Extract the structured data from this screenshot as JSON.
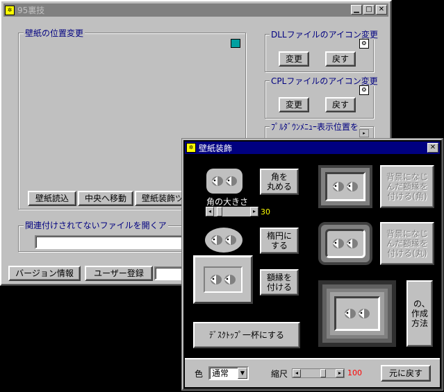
{
  "main_window": {
    "title": "95裏技",
    "wallpaper_group": "壁紙の位置変更",
    "dll_group": "DLLファイルのアイコン変更",
    "dll_change": "変更",
    "dll_back": "戻す",
    "cpl_group": "CPLファイルのアイコン変更",
    "cpl_change": "変更",
    "cpl_back": "戻す",
    "pulldown_group": "ﾌﾟﾙﾀﾞｳﾝﾒﾆｭｰ表示位置を",
    "load_button": "壁紙読込",
    "center_button": "中央へ移動",
    "decor_button": "壁紙装飾ツ",
    "open_group": "関連付けされてないファイルを開くア",
    "open_input": "",
    "version_button": "バージョン情報",
    "register_button": "ユーザー登録",
    "register_input": ""
  },
  "decor_window": {
    "title": "壁紙装飾",
    "round_button": "角を\n丸める",
    "corner_size_label": "角の大きさ",
    "corner_size_value": "30",
    "oval_button": "楕円に\nする",
    "frame_button": "額縁を\n付ける",
    "desktop_button": "ﾃﾞｽｸﾄｯﾌﾟ一杯にする",
    "bg_frame_corner_button": "背景になじ\nんだ額縁を\n付ける(角)",
    "bg_frame_round_button": "背景になじ\nんだ額縁を\n付ける(丸)",
    "howto_button": "の､\n作成\n方法",
    "color_label": "色",
    "color_select": "通常",
    "scale_label": "縮尺",
    "scale_value": "100",
    "reset_button": "元に戻す"
  },
  "colors": {
    "title_active": "#000080",
    "face": "#c0c0c0",
    "desktop": "#000000",
    "scale_value": "#ff0000",
    "corner_value": "#ffff00"
  }
}
